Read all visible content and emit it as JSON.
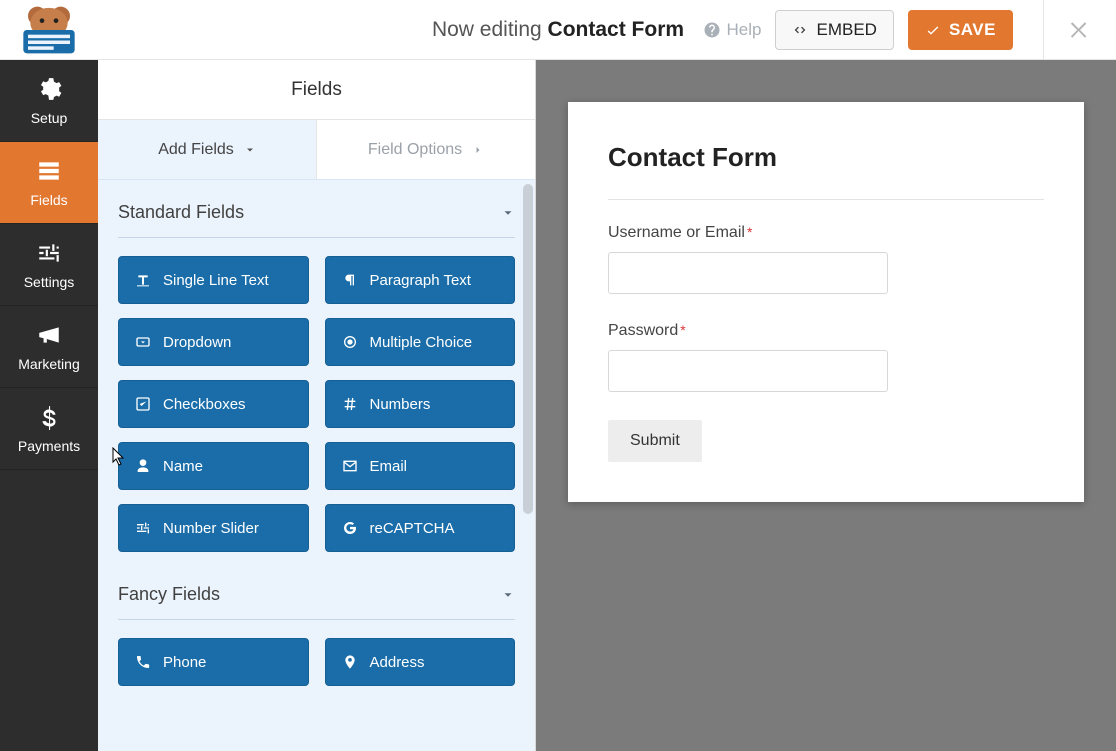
{
  "header": {
    "editing_prefix": "Now editing",
    "form_name": "Contact Form",
    "help_label": "Help",
    "embed_label": "EMBED",
    "save_label": "SAVE"
  },
  "nav": [
    {
      "id": "setup",
      "label": "Setup"
    },
    {
      "id": "fields",
      "label": "Fields"
    },
    {
      "id": "settings",
      "label": "Settings"
    },
    {
      "id": "marketing",
      "label": "Marketing"
    },
    {
      "id": "payments",
      "label": "Payments"
    }
  ],
  "nav_active": "fields",
  "panel": {
    "title": "Fields",
    "tab_add": "Add Fields",
    "tab_options": "Field Options"
  },
  "sections": [
    {
      "title": "Standard Fields",
      "items": [
        {
          "id": "single-line-text",
          "label": "Single Line Text",
          "icon": "text-icon"
        },
        {
          "id": "paragraph-text",
          "label": "Paragraph Text",
          "icon": "paragraph-icon"
        },
        {
          "id": "dropdown",
          "label": "Dropdown",
          "icon": "dropdown-icon"
        },
        {
          "id": "multiple-choice",
          "label": "Multiple Choice",
          "icon": "radio-icon"
        },
        {
          "id": "checkboxes",
          "label": "Checkboxes",
          "icon": "checkbox-icon"
        },
        {
          "id": "numbers",
          "label": "Numbers",
          "icon": "hash-icon"
        },
        {
          "id": "name",
          "label": "Name",
          "icon": "user-icon"
        },
        {
          "id": "email",
          "label": "Email",
          "icon": "envelope-icon"
        },
        {
          "id": "number-slider",
          "label": "Number Slider",
          "icon": "sliders-icon"
        },
        {
          "id": "recaptcha",
          "label": "reCAPTCHA",
          "icon": "google-icon"
        }
      ]
    },
    {
      "title": "Fancy Fields",
      "items": [
        {
          "id": "phone",
          "label": "Phone",
          "icon": "phone-icon"
        },
        {
          "id": "address",
          "label": "Address",
          "icon": "pin-icon"
        }
      ]
    }
  ],
  "form_preview": {
    "title": "Contact Form",
    "fields": [
      {
        "label": "Username or Email",
        "required": true,
        "type": "text"
      },
      {
        "label": "Password",
        "required": true,
        "type": "password"
      }
    ],
    "submit_label": "Submit"
  }
}
